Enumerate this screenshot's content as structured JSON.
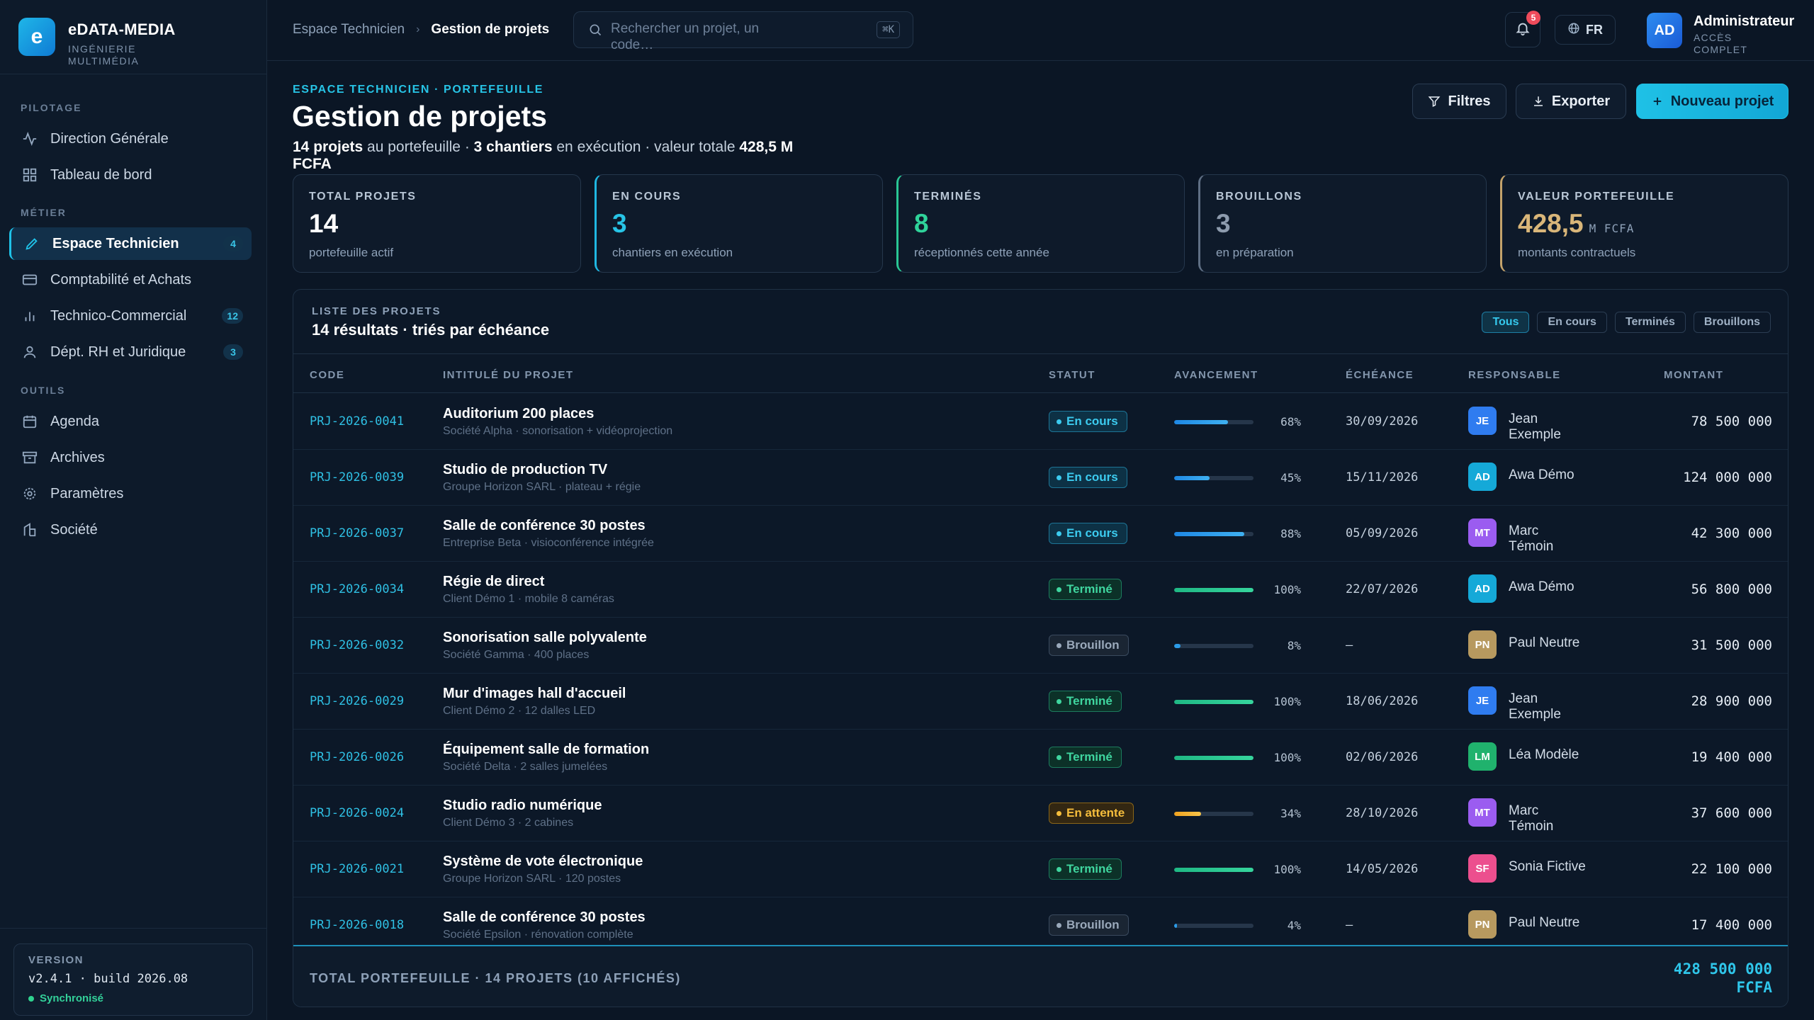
{
  "brand": {
    "logo": "e",
    "name": "eDATA-MEDIA",
    "subtitle": "INGÉNIERIE MULTIMÉDIA"
  },
  "sidebar": {
    "sections": [
      "PILOTAGE",
      "MÉTIER",
      "OUTILS"
    ],
    "items": [
      {
        "label": "Direction Générale",
        "icon": "activity-icon"
      },
      {
        "label": "Tableau de bord",
        "icon": "grid-icon"
      },
      {
        "label": "Espace Technicien",
        "icon": "pen-icon",
        "badge": "4",
        "active": true
      },
      {
        "label": "Comptabilité et Achats",
        "icon": "card-icon"
      },
      {
        "label": "Technico-Commercial",
        "icon": "bar-chart-icon",
        "badge": "12"
      },
      {
        "label": "Dépt. RH et Juridique",
        "icon": "user-icon",
        "badge": "3"
      },
      {
        "label": "Agenda",
        "icon": "calendar-icon"
      },
      {
        "label": "Archives",
        "icon": "archive-icon"
      },
      {
        "label": "Paramètres",
        "icon": "gear-icon"
      },
      {
        "label": "Société",
        "icon": "building-icon"
      }
    ],
    "version": {
      "label": "VERSION",
      "value": "v2.4.1 · build 2026.08",
      "status": "Synchronisé"
    }
  },
  "topbar": {
    "breadcrumb": [
      "Espace Technicien",
      "Gestion de projets"
    ],
    "search_placeholder": "Rechercher un projet, un code…",
    "search_shortcut": "⌘K",
    "notifications": "5",
    "language": "FR",
    "user": {
      "initials": "AD",
      "name": "Administrateur",
      "role": "ACCÈS COMPLET"
    }
  },
  "header": {
    "eyebrow": "ESPACE TECHNICIEN · PORTEFEUILLE",
    "title": "Gestion de projets",
    "summary": {
      "projects": "14 projets",
      "t1": " au portefeuille · ",
      "sites": "3 chantiers",
      "t2": " en exécution · valeur totale ",
      "value": "428,5 M FCFA"
    },
    "buttons": {
      "filters": "Filtres",
      "export": "Exporter",
      "new": "Nouveau projet"
    }
  },
  "kpis": [
    {
      "label": "TOTAL PROJETS",
      "value": "14",
      "unit": "",
      "sub": "portefeuille actif",
      "color": "#ffffff"
    },
    {
      "label": "EN COURS",
      "value": "3",
      "unit": "",
      "sub": "chantiers en exécution",
      "color": "#27c4e6"
    },
    {
      "label": "TERMINÉS",
      "value": "8",
      "unit": "",
      "sub": "réceptionnés cette année",
      "color": "#2fd39a"
    },
    {
      "label": "BROUILLONS",
      "value": "3",
      "unit": "",
      "sub": "en préparation",
      "color": "#8d9bad"
    },
    {
      "label": "VALEUR PORTEFEUILLE",
      "value": "428,5",
      "unit": "M FCFA",
      "sub": "montants contractuels",
      "color": "#d9b679"
    }
  ],
  "table": {
    "eyebrow": "LISTE DES PROJETS",
    "title": "14 résultats · triés par échéance",
    "filters": [
      "Tous",
      "En cours",
      "Terminés",
      "Brouillons"
    ],
    "columns": [
      "CODE",
      "INTITULÉ DU PROJET",
      "STATUT",
      "AVANCEMENT",
      "ÉCHÉANCE",
      "RESPONSABLE",
      "MONTANT"
    ],
    "rows": [
      {
        "code": "PRJ-2026-0041",
        "name": "Auditorium 200 places",
        "desc": "Société Alpha · sonorisation + vidéoprojection",
        "status": "En cours",
        "kind": "cours",
        "progress": 68,
        "pct": "68%",
        "due": "30/09/2026",
        "initials": "JE",
        "person": "Jean Exemple",
        "avatar": "#2f7cf0",
        "amount": "78 500 000"
      },
      {
        "code": "PRJ-2026-0039",
        "name": "Studio de production TV",
        "desc": "Groupe Horizon SARL · plateau + régie",
        "status": "En cours",
        "kind": "cours",
        "progress": 45,
        "pct": "45%",
        "due": "15/11/2026",
        "initials": "AD",
        "person": "Awa Démo",
        "avatar": "#15a9d8",
        "amount": "124 000 000"
      },
      {
        "code": "PRJ-2026-0037",
        "name": "Salle de conférence 30 postes",
        "desc": "Entreprise Beta · visioconférence intégrée",
        "status": "En cours",
        "kind": "cours",
        "progress": 88,
        "pct": "88%",
        "due": "05/09/2026",
        "initials": "MT",
        "person": "Marc Témoin",
        "avatar": "#9b5cf0",
        "amount": "42 300 000"
      },
      {
        "code": "PRJ-2026-0034",
        "name": "Régie de direct",
        "desc": "Client Démo 1 · mobile 8 caméras",
        "status": "Terminé",
        "kind": "term",
        "progress": 100,
        "pct": "100%",
        "due": "22/07/2026",
        "initials": "AD",
        "person": "Awa Démo",
        "avatar": "#15a9d8",
        "amount": "56 800 000"
      },
      {
        "code": "PRJ-2026-0032",
        "name": "Sonorisation salle polyvalente",
        "desc": "Société Gamma · 400 places",
        "status": "Brouillon",
        "kind": "brou",
        "progress": 8,
        "pct": "8%",
        "due": "—",
        "initials": "PN",
        "person": "Paul Neutre",
        "avatar": "#b7995f",
        "amount": "31 500 000"
      },
      {
        "code": "PRJ-2026-0029",
        "name": "Mur d'images hall d'accueil",
        "desc": "Client Démo 2 · 12 dalles LED",
        "status": "Terminé",
        "kind": "term",
        "progress": 100,
        "pct": "100%",
        "due": "18/06/2026",
        "initials": "JE",
        "person": "Jean Exemple",
        "avatar": "#2f7cf0",
        "amount": "28 900 000"
      },
      {
        "code": "PRJ-2026-0026",
        "name": "Équipement salle de formation",
        "desc": "Société Delta · 2 salles jumelées",
        "status": "Terminé",
        "kind": "term",
        "progress": 100,
        "pct": "100%",
        "due": "02/06/2026",
        "initials": "LM",
        "person": "Léa Modèle",
        "avatar": "#20b26d",
        "amount": "19 400 000"
      },
      {
        "code": "PRJ-2026-0024",
        "name": "Studio radio numérique",
        "desc": "Client Démo 3 · 2 cabines",
        "status": "En attente",
        "kind": "att",
        "progress": 34,
        "pct": "34%",
        "due": "28/10/2026",
        "initials": "MT",
        "person": "Marc Témoin",
        "avatar": "#9b5cf0",
        "amount": "37 600 000"
      },
      {
        "code": "PRJ-2026-0021",
        "name": "Système de vote électronique",
        "desc": "Groupe Horizon SARL · 120 postes",
        "status": "Terminé",
        "kind": "term",
        "progress": 100,
        "pct": "100%",
        "due": "14/05/2026",
        "initials": "SF",
        "person": "Sonia Fictive",
        "avatar": "#ec4f8e",
        "amount": "22 100 000"
      },
      {
        "code": "PRJ-2026-0018",
        "name": "Salle de conférence 30 postes",
        "desc": "Société Epsilon · rénovation complète",
        "status": "Brouillon",
        "kind": "brou",
        "progress": 4,
        "pct": "4%",
        "due": "—",
        "initials": "PN",
        "person": "Paul Neutre",
        "avatar": "#b7995f",
        "amount": "17 400 000"
      }
    ],
    "footer": {
      "label": "TOTAL PORTEFEUILLE · 14 PROJETS (10 AFFICHÉS)",
      "amount": "428 500 000",
      "currency": "FCFA"
    }
  }
}
